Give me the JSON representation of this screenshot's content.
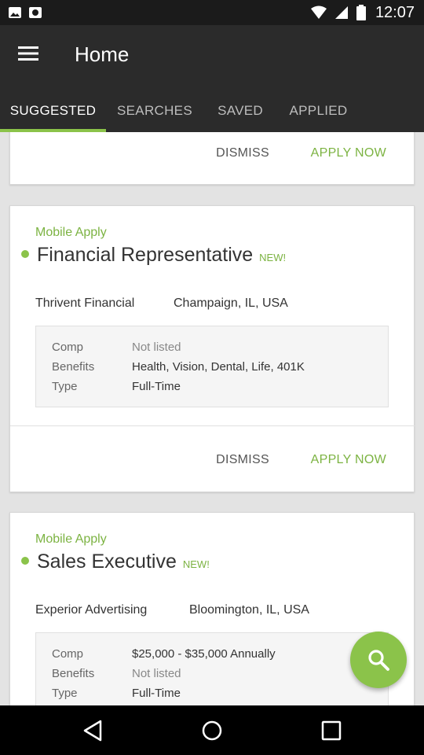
{
  "status_bar": {
    "time": "12:07"
  },
  "app_bar": {
    "title": "Home"
  },
  "tabs": [
    {
      "label": "SUGGESTED",
      "active": true
    },
    {
      "label": "SEARCHES"
    },
    {
      "label": "SAVED"
    },
    {
      "label": "APPLIED"
    }
  ],
  "cards": [
    {
      "dismiss_label": "DISMISS",
      "apply_label": "APPLY NOW"
    },
    {
      "mobile_apply": "Mobile Apply",
      "title": "Financial Representative",
      "badge": "NEW!",
      "company": "Thrivent Financial",
      "location": "Champaign, IL, USA",
      "comp_label": "Comp",
      "comp_value": "Not listed",
      "benefits_label": "Benefits",
      "benefits_value": "Health, Vision, Dental, Life, 401K",
      "type_label": "Type",
      "type_value": "Full-Time",
      "dismiss_label": "DISMISS",
      "apply_label": "APPLY NOW"
    },
    {
      "mobile_apply": "Mobile Apply",
      "title": "Sales Executive",
      "badge": "NEW!",
      "company": "Experior Advertising",
      "location": "Bloomington, IL, USA",
      "comp_label": "Comp",
      "comp_value": "$25,000 - $35,000 Annually",
      "benefits_label": "Benefits",
      "benefits_value": "Not listed",
      "type_label": "Type",
      "type_value": "Full-Time"
    }
  ],
  "fab": {
    "icon": "search-icon"
  },
  "colors": {
    "accent": "#8bc34a",
    "accent_text": "#7cb342",
    "app_bar": "#2b2b2b",
    "status_bar": "#1b1b1b"
  }
}
